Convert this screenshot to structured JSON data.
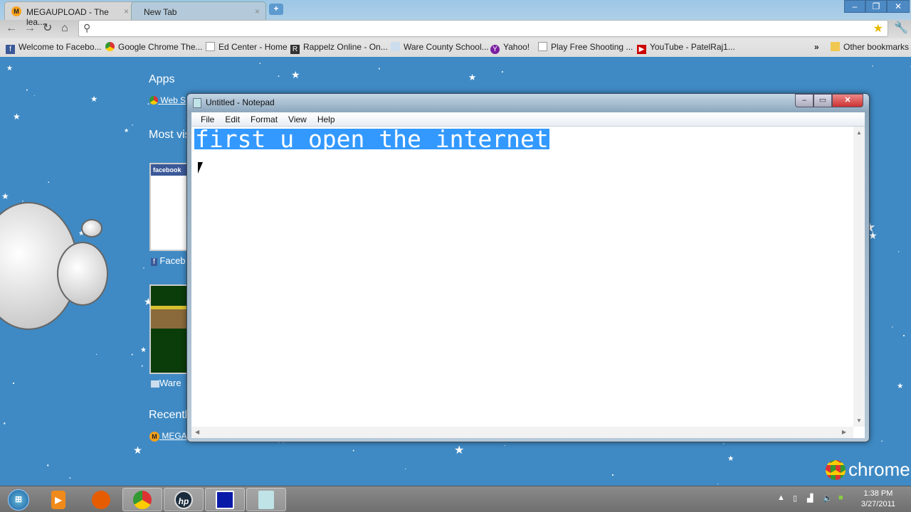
{
  "browser": {
    "tabs": [
      {
        "label": "MEGAUPLOAD - The lea...",
        "icon": "megaupload-icon",
        "active": true
      },
      {
        "label": "New Tab",
        "active": false
      }
    ],
    "omnibox": {
      "value": "",
      "placeholder": ""
    },
    "bookmarks": [
      {
        "label": "Welcome to Facebo...",
        "icon": "facebook-icon"
      },
      {
        "label": "Google Chrome The...",
        "icon": "chrome-icon"
      },
      {
        "label": "Ed Center - Home",
        "icon": "page-icon"
      },
      {
        "label": "Rappelz Online - On...",
        "icon": "rappelz-icon"
      },
      {
        "label": "Ware County School...",
        "icon": "site-icon"
      },
      {
        "label": "Yahoo!",
        "icon": "yahoo-icon"
      },
      {
        "label": "Play Free Shooting ...",
        "icon": "page-icon"
      },
      {
        "label": "YouTube - PatelRaj1...",
        "icon": "youtube-icon"
      }
    ],
    "overflow": "»",
    "other_bookmarks": "Other bookmarks",
    "window_controls": {
      "minimize": "–",
      "restore": "❐",
      "close": "✕"
    }
  },
  "new_tab_page": {
    "apps_heading": "Apps",
    "apps_link": "Web S",
    "most_visited_heading": "Most vis",
    "thumb1_label": "Faceb",
    "thumb1_title": "facebook",
    "thumb2_label": "Ware",
    "recently_heading": "Recently",
    "recent_link": "MEGAU",
    "brand": "chrome"
  },
  "notepad": {
    "title": "Untitled - Notepad",
    "menu": [
      "File",
      "Edit",
      "Format",
      "View",
      "Help"
    ],
    "content": "first u open the internet",
    "selection_color": "#3399ff"
  },
  "taskbar": {
    "time": "1:38 PM",
    "date": "3/27/2011",
    "apps": [
      "start-orb",
      "media-player",
      "mushroom-app",
      "chrome",
      "hp",
      "remote-app",
      "notepad"
    ]
  }
}
